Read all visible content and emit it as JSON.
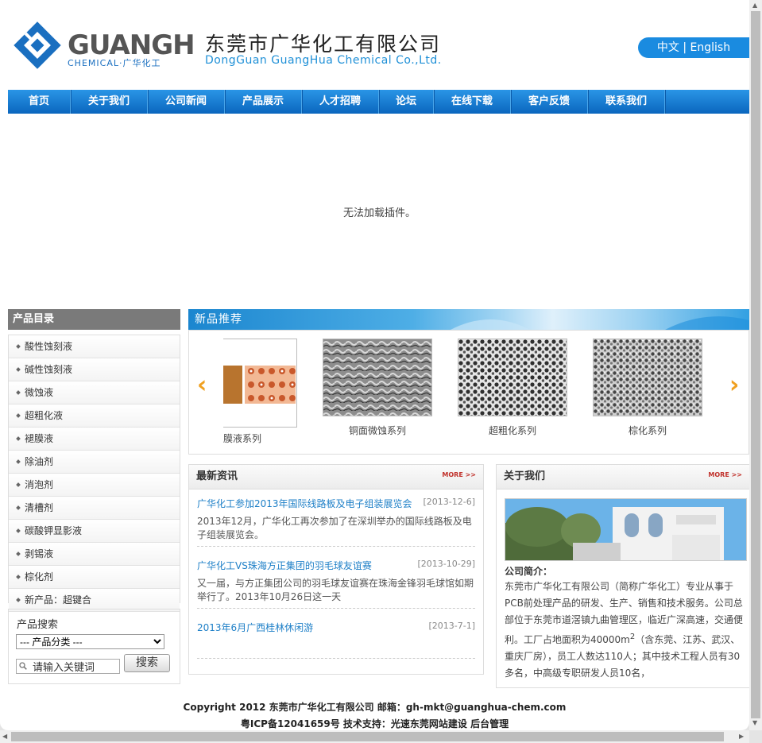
{
  "header": {
    "logo_text": "GUANGHUA",
    "logo_sub": "CHEMICAL·广华化工",
    "company_cn": "东莞市广华化工有限公司",
    "company_en": "DongGuan GuangHua Chemical Co.,Ltd.",
    "lang_cn": "中文",
    "lang_sep": " | ",
    "lang_en": "English"
  },
  "nav": [
    "首页",
    "关于我们",
    "公司新闻",
    "产品展示",
    "人才招聘",
    "论坛",
    "在线下载",
    "客户反馈",
    "联系我们"
  ],
  "banner": {
    "message": "无法加载插件。"
  },
  "sidebar": {
    "title": "产品目录",
    "categories": [
      "酸性蚀刻液",
      "碱性蚀刻液",
      "微蚀液",
      "超粗化液",
      "褪膜液",
      "除油剂",
      "消泡剂",
      "清槽剂",
      "碳酸钾显影液",
      "剥锡液",
      "棕化剂",
      "新产品：超键合"
    ],
    "search": {
      "title": "产品搜索",
      "select_value": "--- 产品分类 ---",
      "input_value": "请输入关键词",
      "button": "搜索"
    }
  },
  "new_products": {
    "title": "新品推荐",
    "items": [
      {
        "caption": "褪膜液系列"
      },
      {
        "caption": "铜面微蚀系列"
      },
      {
        "caption": "超粗化系列"
      },
      {
        "caption": "棕化系列"
      }
    ]
  },
  "news": {
    "title": "最新资讯",
    "more": "MORE >>",
    "items": [
      {
        "title": "广华化工参加2013年国际线路板及电子组装展览会",
        "date": "[2013-12-6]",
        "desc": "2013年12月，广华化工再次参加了在深圳举办的国际线路板及电子组装展览会。"
      },
      {
        "title": "广华化工VS珠海方正集团的羽毛球友谊赛",
        "date": "[2013-10-29]",
        "desc": "又一届，与方正集团公司的羽毛球友谊赛在珠海金锋羽毛球馆如期举行了。2013年10月26日这一天"
      },
      {
        "title": "2013年6月广西桂林休闲游",
        "date": "[2013-7-1]",
        "desc": ""
      }
    ]
  },
  "about": {
    "title": "关于我们",
    "more": "MORE >>",
    "label": "公司简介：",
    "text_part1": "东莞市广华化工有限公司（简称广华化工）专业从事于PCB前处理产品的研发、生产、销售和技术服务。公司总部位于东莞市道滘镇九曲管理区，临近广深高速，交通便利。工厂占地面积为40000m",
    "text_sup": "2",
    "text_part2": "（含东莞、江苏、武汉、重庆厂房），员工人数达110人；其中技术工程人员有30多名，中高级专职研发人员10名，"
  },
  "footer": {
    "line1": "Copyright 2012 东莞市广华化工有限公司 邮箱：gh-mkt@guanghua-chem.com",
    "line2": "粤ICP备12041659号   技术支持：光速东莞网站建设  后台管理"
  },
  "colors": {
    "nav_blue": "#0a66be",
    "link_blue": "#1d7fc7",
    "accent_orange": "#f0a020",
    "more_red": "#c0302a"
  }
}
